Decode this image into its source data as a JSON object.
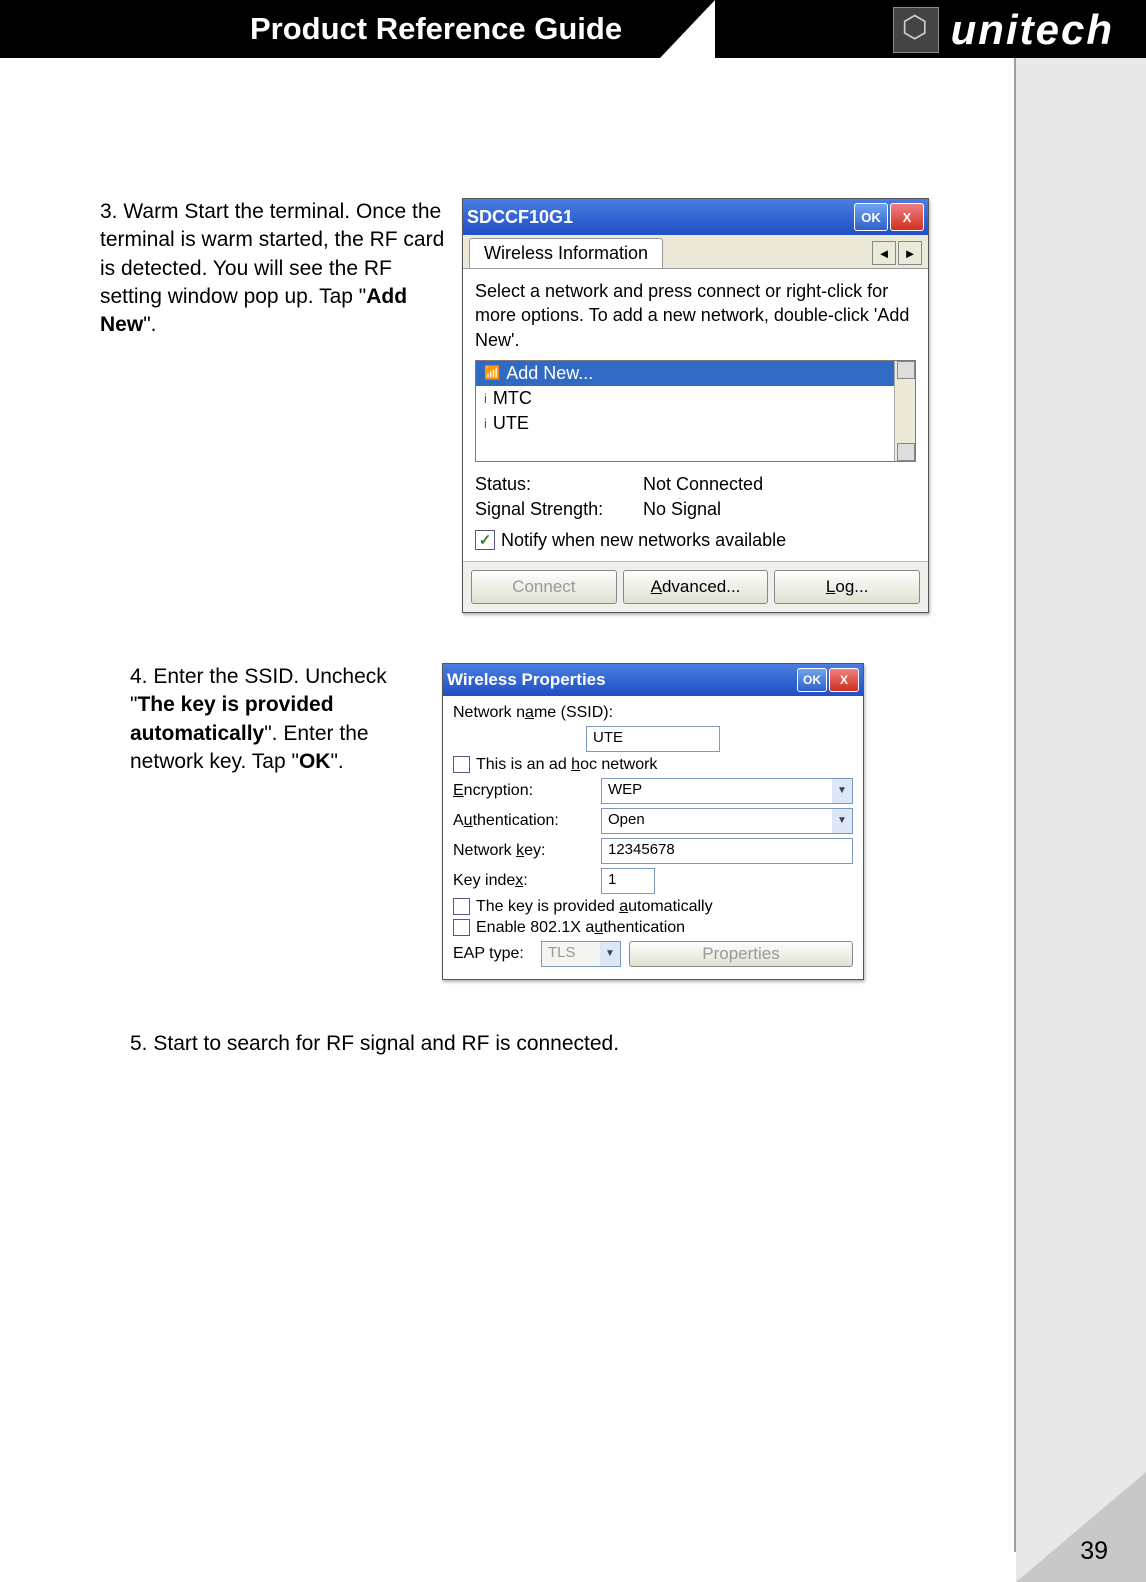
{
  "header": {
    "title": "Product Reference Guide",
    "brand": "unitech"
  },
  "page_number": "39",
  "steps": {
    "s3": {
      "prefix": "3. Warm Start the terminal. Once the terminal is warm started, the RF card is detected. You will see the RF setting window pop up. Tap \"",
      "bold": "Add New",
      "suffix": "\"."
    },
    "s4": {
      "prefix1": "4. Enter the SSID. Uncheck \"",
      "bold1": "The key is provided automatically",
      "mid": "\". Enter the network key. Tap \"",
      "bold2": "OK",
      "suffix": "\"."
    },
    "s5": "5. Start to search for RF signal and RF is connected."
  },
  "screenshot1": {
    "title": "SDCCF10G1",
    "ok": "OK",
    "close": "X",
    "tab": "Wireless Information",
    "instructions": "Select a network and press connect or right-click for more options. To add a new network, double-click 'Add New'.",
    "items": {
      "addnew": "Add New...",
      "mtc": "MTC",
      "ute": "UTE"
    },
    "status_label": "Status:",
    "status_value": "Not Connected",
    "signal_label": "Signal Strength:",
    "signal_value": "No Signal",
    "notify": "Notify when new networks available",
    "btn_connect": "Connect",
    "btn_advanced": "Advanced...",
    "btn_log": "Log..."
  },
  "screenshot2": {
    "title": "Wireless Properties",
    "ok": "OK",
    "close": "X",
    "ssid_label": "Network name (SSID):",
    "ssid_value": "UTE",
    "adhoc": "This is an ad hoc network",
    "enc_label": "Encryption:",
    "enc_value": "WEP",
    "auth_label": "Authentication:",
    "auth_value": "Open",
    "key_label": "Network key:",
    "key_value": "12345678",
    "idx_label": "Key index:",
    "idx_value": "1",
    "auto_key": "The key is provided automatically",
    "enable_1x": "Enable 802.1X authentication",
    "eap_label": "EAP type:",
    "eap_value": "TLS",
    "properties_btn": "Properties"
  }
}
